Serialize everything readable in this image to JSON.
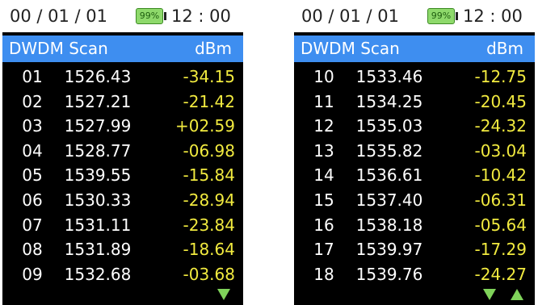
{
  "status": {
    "date": "00 / 01 / 01",
    "battery": "99%",
    "time": "12 : 00"
  },
  "table_header": {
    "title": "DWDM Scan",
    "unit": "dBm"
  },
  "colors": {
    "header_bg": "#3e8ef0",
    "power_text": "#f1ea3f",
    "arrow": "#7fd35a",
    "battery_fill": "#8ed96b"
  },
  "screens": [
    {
      "rows": [
        {
          "ch": "01",
          "wl": "1526.43",
          "pw": "-34.15"
        },
        {
          "ch": "02",
          "wl": "1527.21",
          "pw": "-21.42"
        },
        {
          "ch": "03",
          "wl": "1527.99",
          "pw": "+02.59"
        },
        {
          "ch": "04",
          "wl": "1528.77",
          "pw": "-06.98"
        },
        {
          "ch": "05",
          "wl": "1539.55",
          "pw": "-15.84"
        },
        {
          "ch": "06",
          "wl": "1530.33",
          "pw": "-28.94"
        },
        {
          "ch": "07",
          "wl": "1531.11",
          "pw": "-23.84"
        },
        {
          "ch": "08",
          "wl": "1531.89",
          "pw": "-18.64"
        },
        {
          "ch": "09",
          "wl": "1532.68",
          "pw": "-03.68"
        }
      ],
      "arrows": {
        "down": true,
        "up": false
      }
    },
    {
      "rows": [
        {
          "ch": "10",
          "wl": "1533.46",
          "pw": "-12.75"
        },
        {
          "ch": "11",
          "wl": "1534.25",
          "pw": "-20.45"
        },
        {
          "ch": "12",
          "wl": "1535.03",
          "pw": "-24.32"
        },
        {
          "ch": "13",
          "wl": "1535.82",
          "pw": "-03.04"
        },
        {
          "ch": "14",
          "wl": "1536.61",
          "pw": "-10.42"
        },
        {
          "ch": "15",
          "wl": "1537.40",
          "pw": "-06.31"
        },
        {
          "ch": "16",
          "wl": "1538.18",
          "pw": "-05.64"
        },
        {
          "ch": "17",
          "wl": "1539.97",
          "pw": "-17.29"
        },
        {
          "ch": "18",
          "wl": "1539.76",
          "pw": "-24.27"
        }
      ],
      "arrows": {
        "down": true,
        "up": true
      }
    }
  ]
}
